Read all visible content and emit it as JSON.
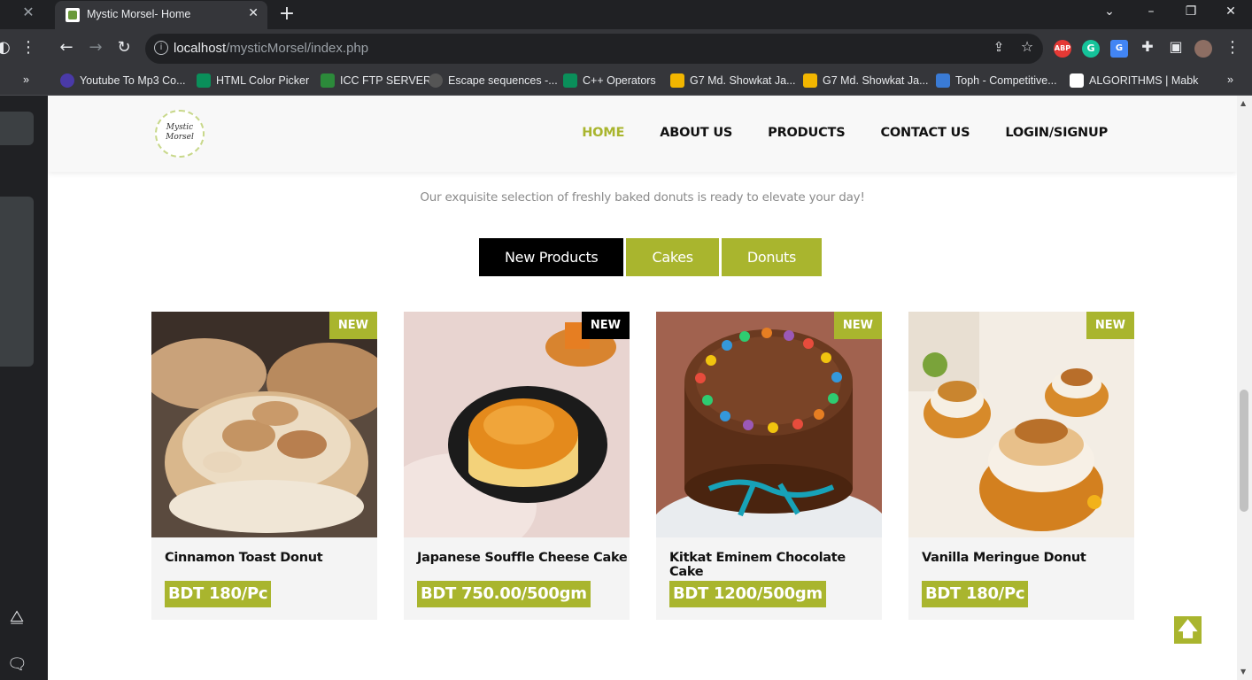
{
  "browser": {
    "tab_title": "Mystic Morsel- Home",
    "url_host": "localhost",
    "url_path": "/mysticMorsel/index.php",
    "tab_close_glyph": "✕",
    "new_tab_glyph": "+",
    "overflow_glyph": "»"
  },
  "bookmarks": [
    {
      "label": "Youtube To Mp3 Co...",
      "icon_color": "#4a3aa8"
    },
    {
      "label": "HTML Color Picker",
      "icon_color": "#0a8f5a"
    },
    {
      "label": "ICC FTP SERVER",
      "icon_color": "#2c8a3a"
    },
    {
      "label": "Escape sequences -...",
      "icon_color": "#555555"
    },
    {
      "label": "C++ Operators",
      "icon_color": "#0a8f5a"
    },
    {
      "label": "G7 Md. Showkat Ja...",
      "icon_color": "#f2b600"
    },
    {
      "label": "G7 Md. Showkat Ja...",
      "icon_color": "#f2b600"
    },
    {
      "label": "Toph - Competitive...",
      "icon_color": "#3a7bd5"
    },
    {
      "label": "ALGORITHMS | Mabk",
      "icon_color": "#ffffff"
    }
  ],
  "site": {
    "logo_text_line1": "Mystic",
    "logo_text_line2": "Morsel",
    "nav": [
      "HOME",
      "ABOUT US",
      "PRODUCTS",
      "CONTACT US",
      "LOGIN/SIGNUP"
    ],
    "tagline": "Our exquisite selection of freshly baked donuts is ready to elevate your day!",
    "filters": [
      "New Products",
      "Cakes",
      "Donuts"
    ],
    "to_top_glyph": "🡅"
  },
  "products": [
    {
      "name": "Cinnamon Toast Donut",
      "price": "BDT 180/Pc",
      "badge": "NEW"
    },
    {
      "name": "Japanese Souffle Cheese Cake",
      "price": "BDT 750.00/500gm",
      "badge": "NEW"
    },
    {
      "name": "Kitkat Eminem Chocolate Cake",
      "price": "BDT 1200/500gm",
      "badge": "NEW"
    },
    {
      "name": "Vanilla Meringue Donut",
      "price": "BDT 180/Pc",
      "badge": "NEW"
    }
  ],
  "colors": {
    "accent": "#a9b52e",
    "text_dark": "#111111",
    "tagline": "#8a8a8a"
  }
}
